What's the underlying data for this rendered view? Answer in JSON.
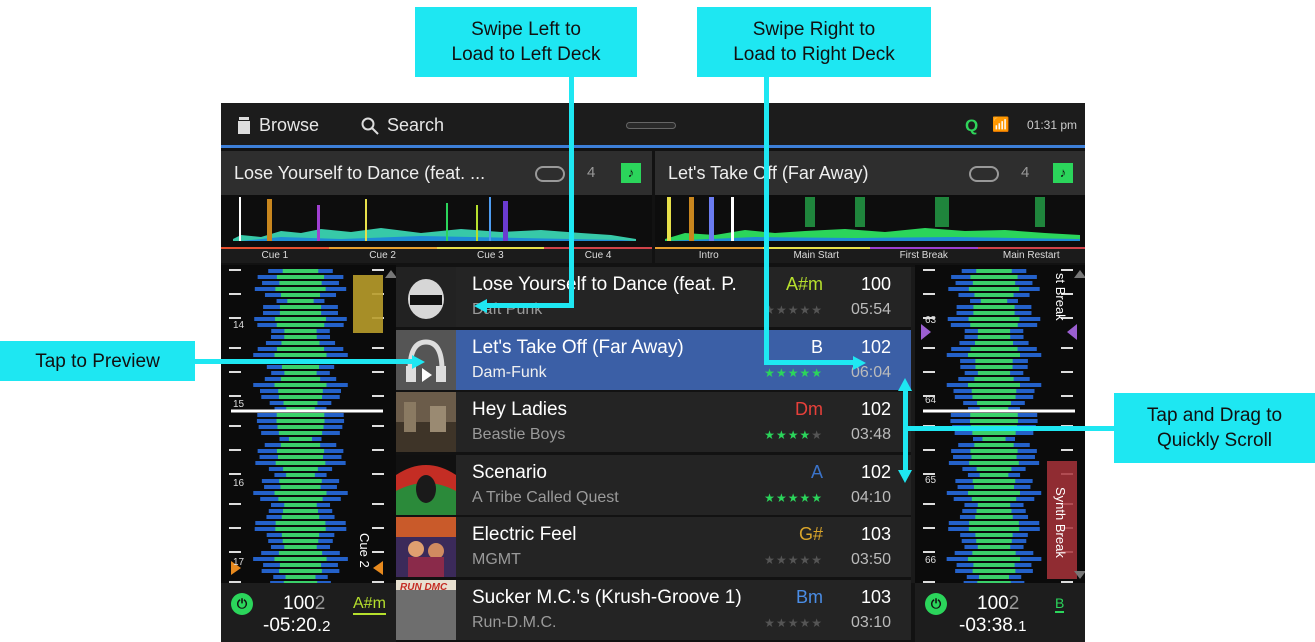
{
  "callouts": {
    "swipe_left": "Swipe Left to\nLoad to Left Deck",
    "swipe_right": "Swipe Right to\nLoad to Right Deck",
    "tap_preview": "Tap to Preview",
    "tap_drag": "Tap and Drag to\nQuickly Scroll"
  },
  "topbar": {
    "browse": "Browse",
    "search": "Search",
    "q": "Q",
    "clock": "01:31 pm"
  },
  "left_deck": {
    "title": "Lose Yourself to Dance (feat. ...",
    "loop": "4",
    "cues": [
      "Cue 1",
      "Cue 2",
      "Cue 3",
      "Cue 4"
    ],
    "markers": [
      "14",
      "15",
      "16",
      "17"
    ],
    "cue_label": "Cue 2",
    "bpm_main": "100",
    "bpm_dec": "2",
    "key": "A#m",
    "time": "-05:20.",
    "time_dec": "2",
    "key_color": "#b6e02d"
  },
  "right_deck": {
    "title": "Let's Take Off (Far Away)",
    "loop": "4",
    "cues": [
      "Intro",
      "Main Start",
      "First Break",
      "Main Restart"
    ],
    "markers": [
      "63",
      "64",
      "65",
      "66"
    ],
    "break_top": "st Break",
    "break_bottom": "Synth Break",
    "bpm_main": "100",
    "bpm_dec": "2",
    "key": "B",
    "time": "-03:38.",
    "time_dec": "1",
    "key_color": "#2bd55b"
  },
  "tracks": [
    {
      "title": "Lose Yourself to Dance (feat. P.",
      "artist": "Daft Punk",
      "key": "A#m",
      "key_color": "#b6e02d",
      "bpm": "100",
      "dur": "05:54",
      "stars": 0
    },
    {
      "title": "Let's Take Off (Far Away)",
      "artist": "Dam-Funk",
      "key": "B",
      "key_color": "#ffffff",
      "bpm": "102",
      "dur": "06:04",
      "stars": 5
    },
    {
      "title": "Hey Ladies",
      "artist": "Beastie Boys",
      "key": "Dm",
      "key_color": "#e6403a",
      "bpm": "102",
      "dur": "03:48",
      "stars": 4
    },
    {
      "title": "Scenario",
      "artist": "A Tribe Called Quest",
      "key": "A",
      "key_color": "#3b73c8",
      "bpm": "102",
      "dur": "04:10",
      "stars": 5
    },
    {
      "title": "Electric Feel",
      "artist": "MGMT",
      "key": "G#",
      "key_color": "#d9a42a",
      "bpm": "103",
      "dur": "03:50",
      "stars": 0
    },
    {
      "title": "Sucker M.C.'s (Krush-Groove 1)",
      "artist": "Run-D.M.C.",
      "key": "Bm",
      "key_color": "#4a8de6",
      "bpm": "103",
      "dur": "03:10",
      "stars": 0
    }
  ],
  "album_art_text": {
    "run_dmc": "RUN DMC"
  },
  "colors": {
    "accent": "#3d7fd8",
    "green": "#2bd55b",
    "callout": "#1ee7f2"
  }
}
